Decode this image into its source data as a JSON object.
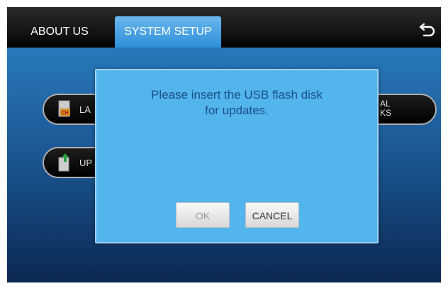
{
  "tabs": [
    {
      "label": "ABOUT US"
    },
    {
      "label": "SYSTEM SETUP"
    }
  ],
  "menu": {
    "language_label": "LA",
    "update_label": "UP",
    "right_label_line1": "AL",
    "right_label_line2": "KS",
    "language_icon_text": "CH"
  },
  "dialog": {
    "message": "Please insert the USB flash disk\nfor updates.",
    "ok_label": "OK",
    "cancel_label": "CANCEL"
  },
  "colors": {
    "accent": "#3a9ee3",
    "dialog_bg": "#52b5ec",
    "message_text": "#1b4f86"
  },
  "icons": [
    "back-arrow-icon",
    "language-icon",
    "update-icon"
  ]
}
